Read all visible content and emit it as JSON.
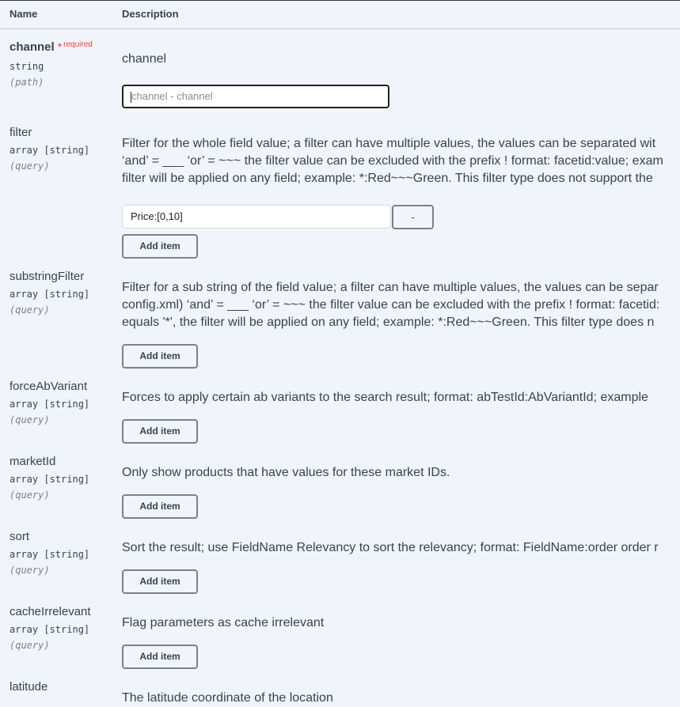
{
  "header": {
    "name": "Name",
    "description": "Description"
  },
  "required_label": "required",
  "required_star": "*",
  "add_item_label": "Add item",
  "remove_label": "-",
  "params": {
    "channel": {
      "name": "channel",
      "type": "string",
      "in": "(path)",
      "description": "channel",
      "input_placeholder": "channel - channel"
    },
    "filter": {
      "name": "filter",
      "type": "array [string]",
      "in": "(query)",
      "description_lines": [
        "Filter for the whole field value; a filter can have multiple values, the values can be separated wit",
        "‘and’ = ___ ‘or’ = ~~~ the filter value can be excluded with the prefix ! format: facetid:value; exam",
        "filter will be applied on any field; example: *:Red~~~Green. This filter type does not support the"
      ],
      "item_value": "Price:[0,10]"
    },
    "substringFilter": {
      "name": "substringFilter",
      "type": "array [string]",
      "in": "(query)",
      "description_lines": [
        "Filter for a sub string of the field value; a filter can have multiple values, the values can be separ",
        "config.xml) ‘and’ = ___ ‘or’ = ~~~ the filter value can be excluded with the prefix ! format: facetid:",
        "equals '*', the filter will be applied on any field; example: *:Red~~~Green. This filter type does n"
      ]
    },
    "forceAbVariant": {
      "name": "forceAbVariant",
      "type": "array [string]",
      "in": "(query)",
      "description": "Forces to apply certain ab variants to the search result; format: abTestId:AbVariantId; example"
    },
    "marketId": {
      "name": "marketId",
      "type": "array [string]",
      "in": "(query)",
      "description": "Only show products that have values for these market IDs."
    },
    "sort": {
      "name": "sort",
      "type": "array [string]",
      "in": "(query)",
      "description": "Sort the result; use FieldName Relevancy to sort the relevancy; format: FieldName:order order r"
    },
    "cacheIrrelevant": {
      "name": "cacheIrrelevant",
      "type": "array [string]",
      "in": "(query)",
      "description": "Flag parameters as cache irrelevant"
    },
    "latitude": {
      "name": "latitude",
      "description": "The latitude coordinate of the location"
    }
  }
}
